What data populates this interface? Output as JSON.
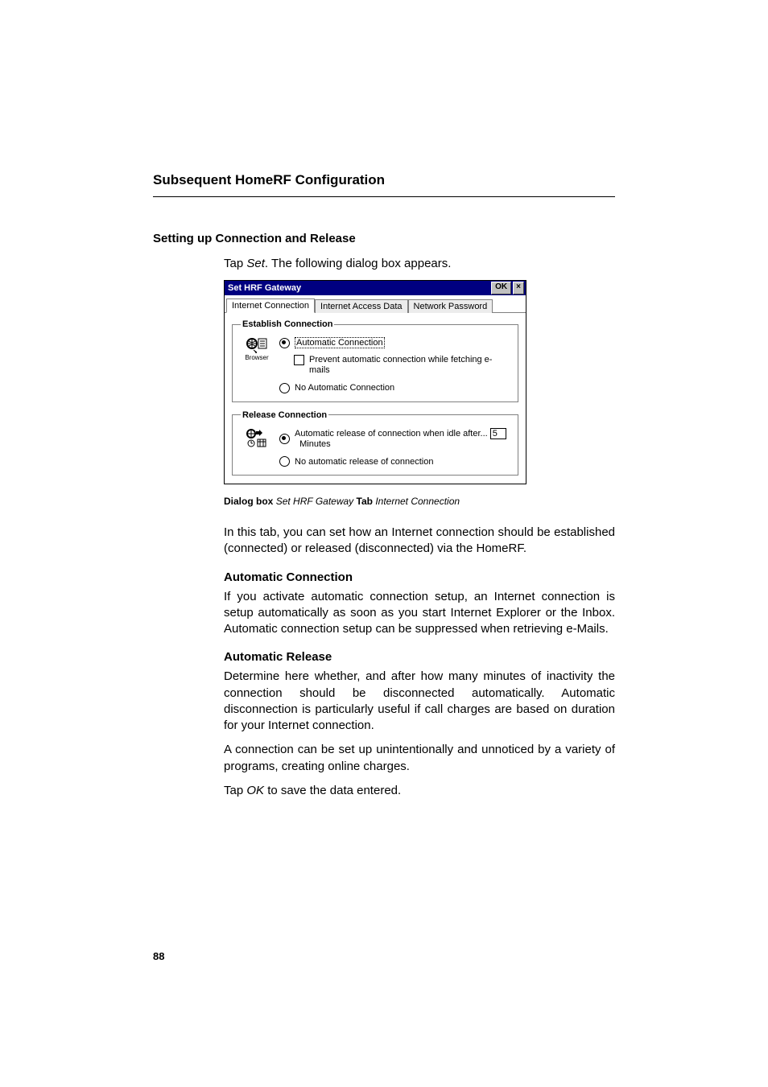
{
  "chapter_title": "Subsequent HomeRF Configuration",
  "section_title": "Setting up Connection and Release",
  "intro_prefix": "Tap ",
  "intro_italic": "Set",
  "intro_suffix": ". The following dialog box appears.",
  "dialog": {
    "title": "Set HRF Gateway",
    "ok_label": "OK",
    "close_label": "×",
    "tabs": [
      "Internet Connection",
      "Internet Access Data",
      "Network Password"
    ],
    "establish": {
      "legend": "Establish Connection",
      "icon_label": "Browser",
      "radio_auto": "Automatic Connection",
      "checkbox": "Prevent automatic connection while fetching e-mails",
      "radio_noauto": "No Automatic Connection"
    },
    "release": {
      "legend": "Release Connection",
      "radio_auto_prefix": "Automatic release of connection when idle after...",
      "idle_value": "5",
      "minutes": "Minutes",
      "radio_noauto": "No automatic release of connection"
    }
  },
  "caption": {
    "label1": "Dialog box",
    "value1": "Set HRF Gateway",
    "label2": "Tab",
    "value2": "Internet Connection"
  },
  "desc_para": "In this tab, you can set how an Internet connection should be established (connected) or released (disconnected) via the HomeRF.",
  "auto_conn": {
    "heading": "Automatic Connection",
    "body": "If you activate automatic connection setup, an Internet connection is setup automatically as soon as you start Internet Explorer or the Inbox. Automatic connection setup can be suppressed when retrieving e-Mails."
  },
  "auto_rel": {
    "heading": "Automatic Release",
    "body1": "Determine here whether, and after how many minutes of inactivity the connection should be disconnected automatically. Automatic disconnection is particularly useful if call charges are based on duration for your Internet connection.",
    "body2": "A connection can be set up unintentionally and unnoticed by a variety of programs, creating online charges.",
    "tap_prefix": "Tap ",
    "tap_italic": "OK",
    "tap_suffix": " to save the data entered."
  },
  "page_number": "88"
}
